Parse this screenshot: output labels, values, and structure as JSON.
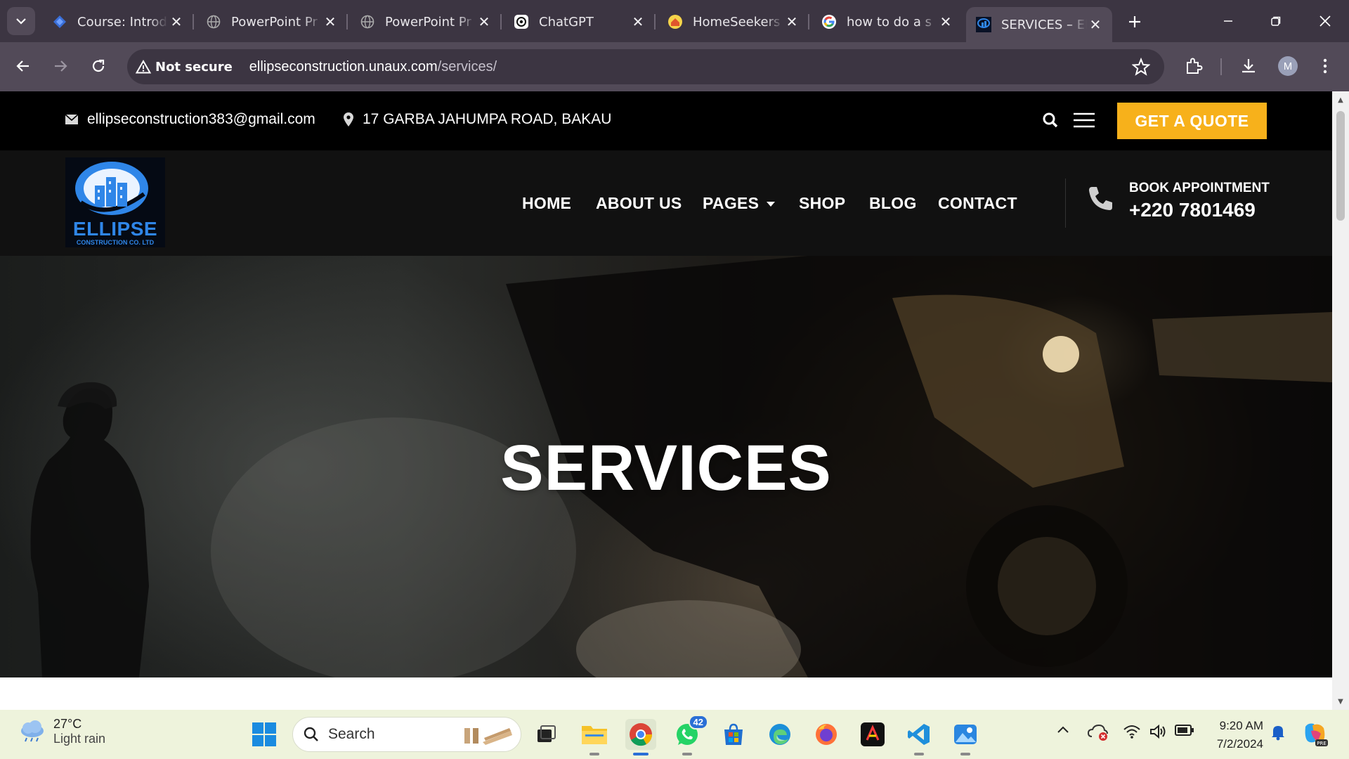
{
  "browser": {
    "tabs": [
      {
        "title": "Course: Introd",
        "favicon": "course-diamond-icon",
        "active": false
      },
      {
        "title": "PowerPoint Pr",
        "favicon": "globe-icon",
        "active": false
      },
      {
        "title": "PowerPoint Pr",
        "favicon": "globe-icon",
        "active": false
      },
      {
        "title": "ChatGPT",
        "favicon": "chatgpt-icon",
        "active": false
      },
      {
        "title": "HomeSeekers",
        "favicon": "homeseekers-icon",
        "active": false
      },
      {
        "title": "how to do a s",
        "favicon": "google-icon",
        "active": true,
        "note_hidden": false
      },
      {
        "title": "SERVICES – Ell",
        "favicon": "ellipse-site-icon",
        "active": true
      }
    ],
    "security_label": "Not secure",
    "url_host": "ellipseconstruction.unaux.com",
    "url_path": "/services/",
    "profile_initial": "M"
  },
  "site": {
    "topbar": {
      "email": "ellipseconstruction383@gmail.com",
      "address": "17 GARBA JAHUMPA ROAD, BAKAU",
      "quote_button": "GET A QUOTE"
    },
    "logo": {
      "word": "ELLIPSE",
      "sub": "CONSTRUCTION CO. LTD"
    },
    "nav": [
      "HOME",
      "ABOUT US",
      "PAGES",
      "SHOP",
      "BLOG",
      "CONTACT"
    ],
    "appointment": {
      "label": "BOOK APPOINTMENT",
      "phone": "+220 7801469"
    },
    "hero_title": "SERVICES",
    "colors": {
      "accent": "#f7b11b",
      "logo_blue": "#2f86e8"
    }
  },
  "taskbar": {
    "weather_temp": "27°C",
    "weather_cond": "Light rain",
    "search_placeholder": "Search",
    "whatsapp_badge": "42",
    "time": "9:20 AM",
    "date": "7/2/2024"
  }
}
